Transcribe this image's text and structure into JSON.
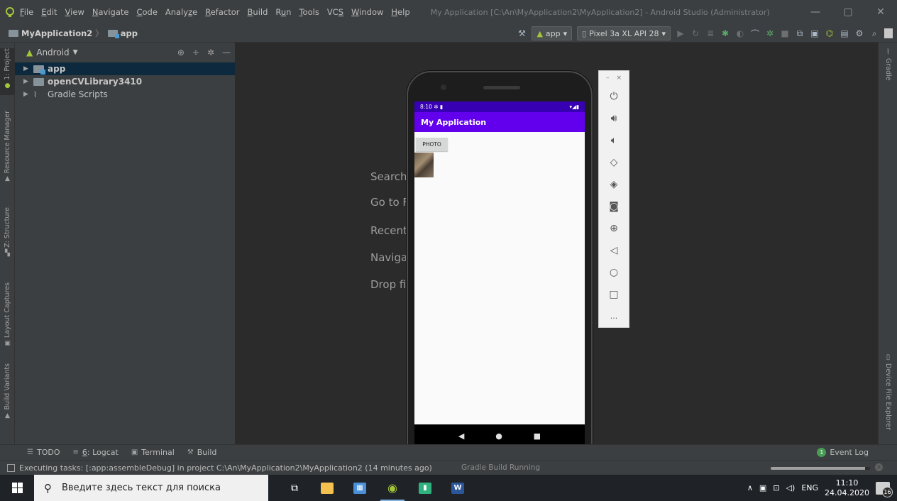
{
  "menu": {
    "items": [
      {
        "pre": "",
        "u": "F",
        "post": "ile"
      },
      {
        "pre": "",
        "u": "E",
        "post": "dit"
      },
      {
        "pre": "",
        "u": "V",
        "post": "iew"
      },
      {
        "pre": "",
        "u": "N",
        "post": "avigate"
      },
      {
        "pre": "",
        "u": "C",
        "post": "ode"
      },
      {
        "pre": "Analy",
        "u": "z",
        "post": "e"
      },
      {
        "pre": "",
        "u": "R",
        "post": "efactor"
      },
      {
        "pre": "",
        "u": "B",
        "post": "uild"
      },
      {
        "pre": "R",
        "u": "u",
        "post": "n"
      },
      {
        "pre": "",
        "u": "T",
        "post": "ools"
      },
      {
        "pre": "VC",
        "u": "S",
        "post": ""
      },
      {
        "pre": "",
        "u": "W",
        "post": "indow"
      },
      {
        "pre": "",
        "u": "H",
        "post": "elp"
      }
    ],
    "window_title": "My Application [C:\\An\\MyApplication2\\MyApplication2] - Android Studio (Administrator)",
    "minimize": "—",
    "restore": "▢",
    "close": "✕"
  },
  "nav": {
    "project": "MyApplication2",
    "sep": "〉",
    "module": "app",
    "run_config": "app",
    "device": "Pixel 3a XL API 28"
  },
  "left_tabs": {
    "project": "1: Project",
    "resource_manager": "Resource Manager",
    "structure": "Z: Structure",
    "layout_captures": "Layout Captures",
    "build_variants": "Build Variants"
  },
  "project_panel": {
    "view": "Android",
    "tree": [
      {
        "label": "app",
        "icon": "app",
        "bold": true,
        "selected": true
      },
      {
        "label": "openCVLibrary3410",
        "icon": "lib",
        "bold": true,
        "selected": false
      },
      {
        "label": "Gradle Scripts",
        "icon": "gradle",
        "bold": false,
        "selected": false
      }
    ]
  },
  "editor_hints": [
    "Search",
    "Go to F",
    "Recent",
    "Navigat",
    "Drop fil"
  ],
  "right_tabs": {
    "gradle": "Gradle",
    "device_file_explorer": "Device File Explorer"
  },
  "bottom_tabs": {
    "todo": "TODO",
    "logcat_prefix": "",
    "logcat_u": "6",
    "logcat_rest": ": Logcat",
    "terminal": "Terminal",
    "build": "Build",
    "event_log": "Event Log",
    "event_log_count": "1"
  },
  "status": {
    "message": "Executing tasks: [:app:assembleDebug] in project C:\\An\\MyApplication2\\MyApplication2 (14 minutes ago)",
    "gradle": "Gradle Build Running",
    "progress_fraction": 0.95
  },
  "phone": {
    "time": "8:10",
    "app_title": "My Application",
    "button": "PHOTO",
    "nav_back": "◀",
    "nav_home": "●",
    "nav_recent": "■"
  },
  "emulator_bar": {
    "minimize": "–",
    "close": "×",
    "more": "..."
  },
  "taskbar": {
    "search_placeholder": "Введите здесь текст для поиска",
    "lang": "ENG",
    "time": "11:10",
    "date": "24.04.2020",
    "notifications": "16"
  },
  "colors": {
    "status_bar": "#3700b3",
    "app_bar": "#6200ee",
    "ide_bg": "#2b2b2b",
    "panel_bg": "#3c3f41",
    "selection": "#0d293e"
  }
}
